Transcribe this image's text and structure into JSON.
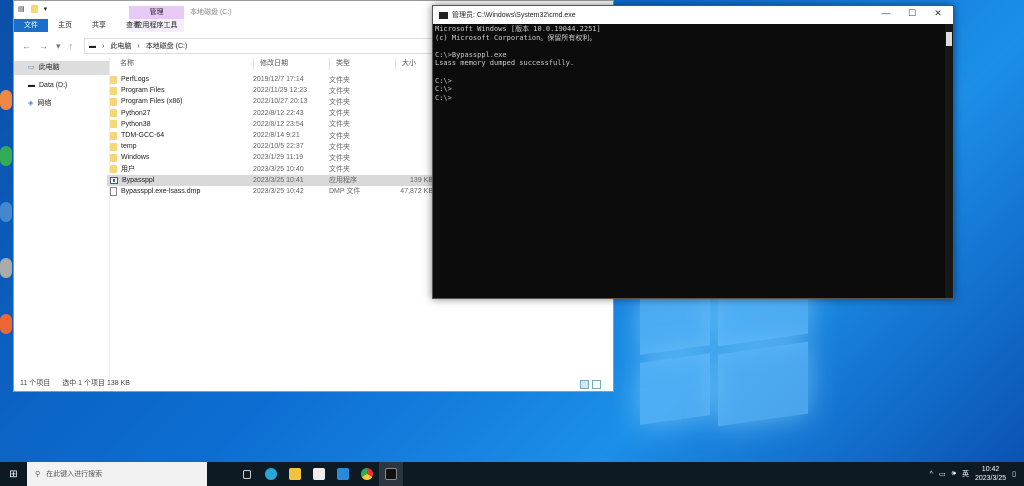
{
  "explorer": {
    "ribbon_tabs": [
      "文件",
      "主页",
      "共享",
      "查看"
    ],
    "context_header": "管理",
    "context_tab": "应用程序工具",
    "window_title": "本地磁盘 (C:)",
    "breadcrumb": [
      "此电脑",
      "本地磁盘 (C:)"
    ],
    "nav_items": [
      {
        "label": "此电脑",
        "selected": true
      },
      {
        "label": "Data (D:)"
      },
      {
        "label": "网络"
      }
    ],
    "columns": [
      "名称",
      "修改日期",
      "类型",
      "大小"
    ],
    "files": [
      {
        "name": "PerfLogs",
        "date": "2019/12/7 17:14",
        "type": "文件夹",
        "size": "",
        "icon": "folder"
      },
      {
        "name": "Program Files",
        "date": "2022/11/29 12:23",
        "type": "文件夹",
        "size": "",
        "icon": "folder"
      },
      {
        "name": "Program Files (x86)",
        "date": "2022/10/27 20:13",
        "type": "文件夹",
        "size": "",
        "icon": "folder"
      },
      {
        "name": "Python27",
        "date": "2022/8/12 22:43",
        "type": "文件夹",
        "size": "",
        "icon": "folder"
      },
      {
        "name": "Python38",
        "date": "2022/8/12 23:54",
        "type": "文件夹",
        "size": "",
        "icon": "folder"
      },
      {
        "name": "TDM-GCC-64",
        "date": "2022/8/14 9:21",
        "type": "文件夹",
        "size": "",
        "icon": "folder"
      },
      {
        "name": "temp",
        "date": "2022/10/5 22:37",
        "type": "文件夹",
        "size": "",
        "icon": "folder"
      },
      {
        "name": "Windows",
        "date": "2023/1/29 11:19",
        "type": "文件夹",
        "size": "",
        "icon": "folder"
      },
      {
        "name": "用户",
        "date": "2023/3/25 10:40",
        "type": "文件夹",
        "size": "",
        "icon": "folder"
      },
      {
        "name": "Bypassppl",
        "date": "2023/3/25 10:41",
        "type": "应用程序",
        "size": "139 KB",
        "icon": "exe",
        "selected": true
      },
      {
        "name": "Bypassppl.exe-lsass.dmp",
        "date": "2023/3/25 10:42",
        "type": "DMP 文件",
        "size": "47,872 KB",
        "icon": "file"
      }
    ],
    "status_count": "11 个项目",
    "status_selected": "选中 1 个项目  138 KB"
  },
  "cmd": {
    "title": "管理员: C:\\Windows\\System32\\cmd.exe",
    "output": "Microsoft Windows [版本 10.0.19044.2251]\n(c) Microsoft Corporation。保留所有权利。\n\nC:\\>Bypassppl.exe\nLsass memory dumped successfully.\n\nC:\\>\nC:\\>\nC:\\>"
  },
  "taskbar": {
    "search_placeholder": "在此键入进行搜索",
    "ime": "英",
    "time": "10:42",
    "date": "2023/3/25"
  }
}
